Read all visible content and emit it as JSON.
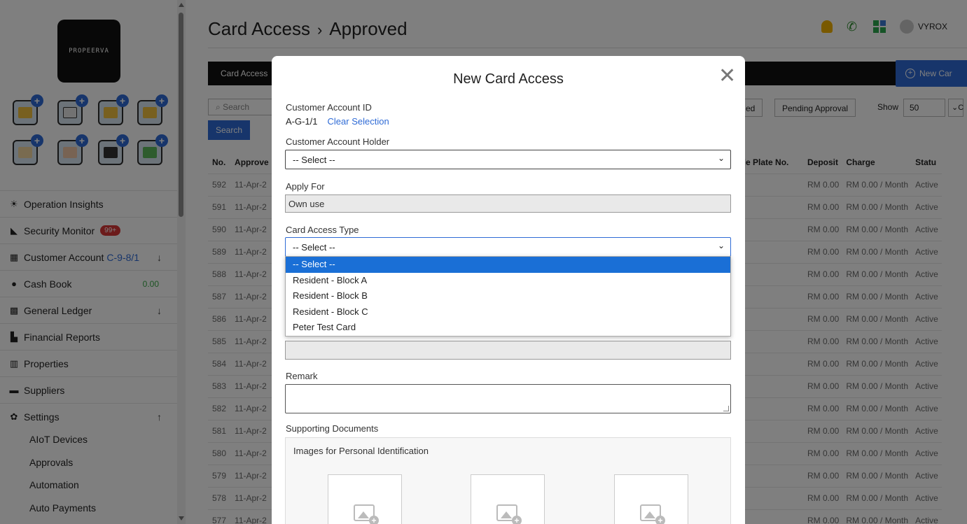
{
  "sidebar": {
    "logo_text": "PROPEERVA",
    "items": [
      {
        "label": "Operation Insights",
        "icon": "bulb-icon"
      },
      {
        "label": "Security Monitor",
        "badge": "99+",
        "icon": "car-icon"
      },
      {
        "label": "Customer Account",
        "account": "C-9-8/1",
        "icon": "table-icon"
      },
      {
        "label": "Cash Book",
        "amount": "0.00",
        "icon": "dollar-icon"
      },
      {
        "label": "General Ledger",
        "icon": "calculator-icon"
      },
      {
        "label": "Financial Reports",
        "icon": "report-icon"
      },
      {
        "label": "Properties",
        "icon": "building-icon"
      },
      {
        "label": "Suppliers",
        "icon": "truck-icon"
      },
      {
        "label": "Settings",
        "icon": "gear-icon"
      }
    ],
    "sub_items": [
      "AIoT Devices",
      "Approvals",
      "Automation",
      "Auto Payments"
    ]
  },
  "header": {
    "crumb_root": "Card Access",
    "crumb_sep": "›",
    "crumb_current": "Approved",
    "user": "VYROX"
  },
  "toolbar": {
    "tab_label": "Card Access",
    "new_button": "New Car",
    "search_placeholder": "Search",
    "search_button": "Search",
    "filter_partial": "ed",
    "filter_pending": "Pending Approval",
    "show_label": "Show",
    "show_value": "50",
    "show_extra": "C"
  },
  "table": {
    "left_headers": [
      "No.",
      "Approve"
    ],
    "right_headers": [
      "cle Plate No.",
      "Deposit",
      "Charge",
      "Statu"
    ],
    "rows": [
      {
        "no": "592",
        "date": "11-Apr-2"
      },
      {
        "no": "591",
        "date": "11-Apr-2"
      },
      {
        "no": "590",
        "date": "11-Apr-2"
      },
      {
        "no": "589",
        "date": "11-Apr-2"
      },
      {
        "no": "588",
        "date": "11-Apr-2"
      },
      {
        "no": "587",
        "date": "11-Apr-2"
      },
      {
        "no": "586",
        "date": "11-Apr-2"
      },
      {
        "no": "585",
        "date": "11-Apr-2"
      },
      {
        "no": "584",
        "date": "11-Apr-2"
      },
      {
        "no": "583",
        "date": "11-Apr-2"
      },
      {
        "no": "582",
        "date": "11-Apr-2"
      },
      {
        "no": "581",
        "date": "11-Apr-2"
      },
      {
        "no": "580",
        "date": "11-Apr-2"
      },
      {
        "no": "579",
        "date": "11-Apr-2"
      },
      {
        "no": "578",
        "date": "11-Apr-2"
      },
      {
        "no": "577",
        "date": "11-Apr-2"
      }
    ],
    "deposit": "RM 0.00",
    "charge": "RM 0.00 / Month",
    "status": "Active"
  },
  "modal": {
    "title": "New Card Access",
    "customer_id_label": "Customer Account ID",
    "customer_id_value": "A-G-1/1",
    "clear_selection": "Clear Selection",
    "holder_label": "Customer Account Holder",
    "holder_value": "-- Select --",
    "apply_label": "Apply For",
    "apply_value": "Own use",
    "type_label": "Card Access Type",
    "type_value": "-- Select --",
    "remark_label": "Remark",
    "docs_label": "Supporting Documents",
    "docs_sub": "Images for Personal Identification"
  },
  "dropdown": {
    "options": [
      "-- Select --",
      "Resident - Block A",
      "Resident - Block B",
      "Resident - Block C",
      "Peter Test Card"
    ],
    "selected_index": 0
  },
  "colors": {
    "accent": "#2f6bd6",
    "badge": "#d93636",
    "option_highlight": "#1a6fd6"
  }
}
